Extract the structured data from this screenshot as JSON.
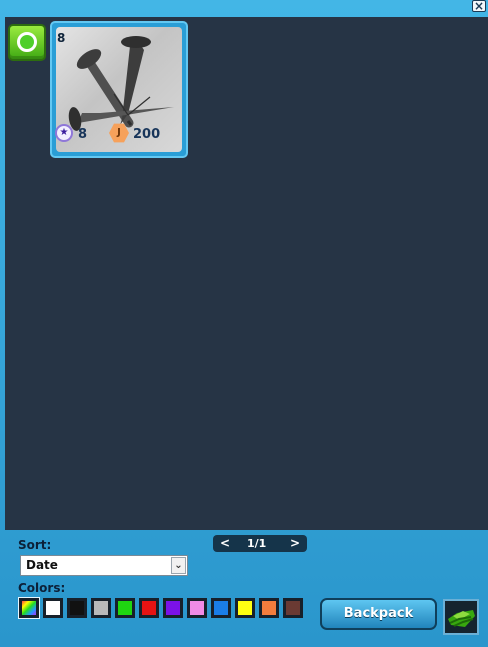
{
  "window": {
    "close_label": "×"
  },
  "inventory": {
    "items": [
      {
        "name": "Nails",
        "quantity": "8",
        "level": "8",
        "cost": "200",
        "icon": "nails-icon"
      }
    ]
  },
  "toolbar": {
    "sort_label": "Sort:",
    "sort_value": "Date",
    "pager": {
      "prev": "<",
      "page_text": "1/1",
      "next": ">"
    },
    "colors_label": "Colors:",
    "colors": [
      "all",
      "#ffffff",
      "#111111",
      "#b9b9b9",
      "#1fd611",
      "#e61313",
      "#7b12e8",
      "#f08be6",
      "#1a7ee8",
      "#ffff12",
      "#f47d3d",
      "#6a3a33"
    ],
    "backpack_label": "Backpack"
  }
}
